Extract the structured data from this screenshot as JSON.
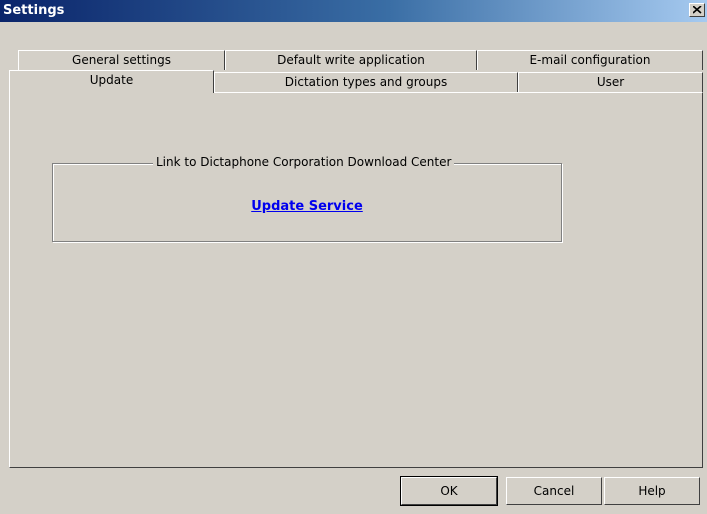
{
  "window": {
    "title": "Settings",
    "close_icon": "close-x-icon"
  },
  "tabs": {
    "row1": [
      "General settings",
      "Default write application",
      "E-mail configuration"
    ],
    "row2": [
      "Update",
      "Dictation types and groups",
      "User"
    ],
    "selected": "Update"
  },
  "update": {
    "group_label": "Link to Dictaphone Corporation Download Center",
    "link_label": "Update Service"
  },
  "buttons": {
    "ok": "OK",
    "cancel": "Cancel",
    "help": "Help"
  },
  "colors": {
    "link": "#0000ee",
    "titlebar_start": "#0a246a",
    "titlebar_end": "#a6caf0"
  }
}
